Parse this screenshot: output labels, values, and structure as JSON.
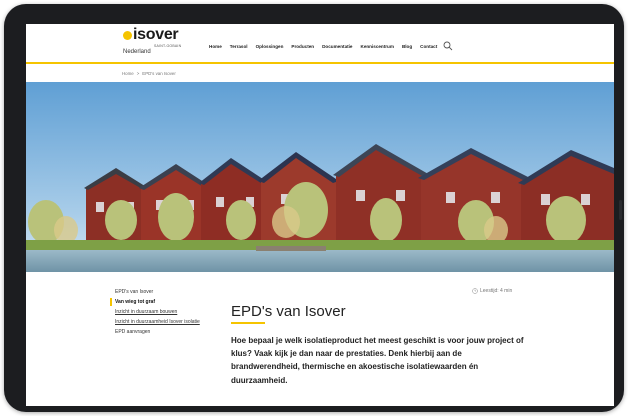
{
  "brand": {
    "logo_text": "isover",
    "logo_subtext": "SAINT-GOBAIN",
    "region": "Nederland",
    "accent_color": "#f5c400"
  },
  "nav": {
    "items": [
      {
        "label": "Home"
      },
      {
        "label": "Terrasol"
      },
      {
        "label": "Oplossingen"
      },
      {
        "label": "Producten"
      },
      {
        "label": "Documentatie"
      },
      {
        "label": "Kenniscentrum"
      },
      {
        "label": "Blog"
      },
      {
        "label": "Contact"
      }
    ],
    "search_icon": "search-icon"
  },
  "breadcrumb": {
    "home": "Home",
    "separator": ">",
    "current": "EPD's van Isover"
  },
  "sidebar": {
    "items": [
      {
        "label": "EPD's van Isover",
        "state": "plain"
      },
      {
        "label": "Van wieg tot graf",
        "state": "active"
      },
      {
        "label": "Inzicht in duurzaam bouwen",
        "state": "link"
      },
      {
        "label": "Inzicht in duurzaamheid Isover isolatie",
        "state": "link"
      },
      {
        "label": "EPD aanvragen",
        "state": "plain"
      }
    ]
  },
  "article": {
    "read_time": "Leestijd: 4 min",
    "clock_icon": "clock-icon",
    "title": "EPD's van Isover",
    "intro": "Hoe bepaal je welk isolatieproduct het meest geschikt is voor jouw project of klus? Vaak kijk je dan naar de prestaties. Denk hierbij aan de brandwerendheid, thermische en akoestische isolatiewaarden én duurzaamheid."
  }
}
